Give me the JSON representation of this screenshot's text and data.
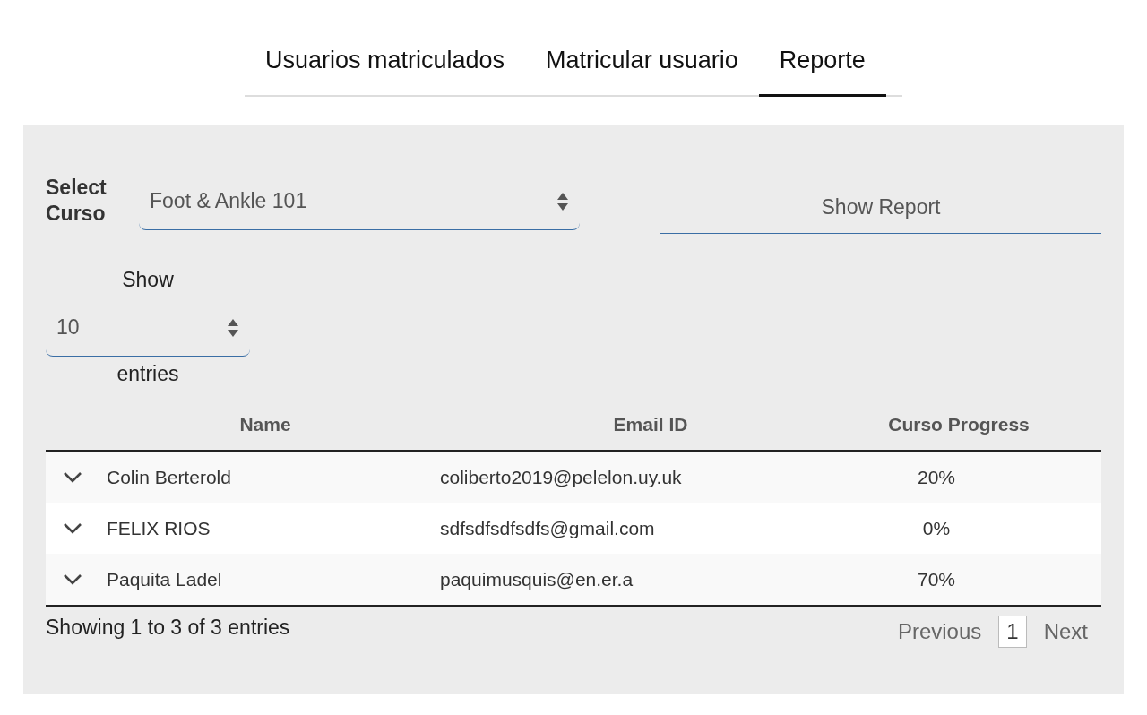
{
  "tabs": [
    {
      "label": "Usuarios matriculados",
      "selected": false
    },
    {
      "label": "Matricular usuario",
      "selected": false
    },
    {
      "label": "Reporte",
      "selected": true
    }
  ],
  "course_select": {
    "label": "Select Curso",
    "value": "Foot & Ankle 101"
  },
  "show_report_button": "Show Report",
  "length_control": {
    "prefix": "Show",
    "value": "10",
    "suffix": "entries"
  },
  "table": {
    "columns": [
      "Name",
      "Email ID",
      "Curso Progress"
    ],
    "rows": [
      {
        "name": "Colin Berterold",
        "email": "coliberto2019@pelelon.uy.uk",
        "progress": "20%"
      },
      {
        "name": "FELIX RIOS",
        "email": "sdfsdfsdfsdfs@gmail.com",
        "progress": "0%"
      },
      {
        "name": "Paquita Ladel",
        "email": "paquimusquis@en.er.a",
        "progress": "70%"
      }
    ]
  },
  "info": "Showing 1 to 3 of 3 entries",
  "pagination": [
    {
      "label": "Previous",
      "kind": "link",
      "selected": false
    },
    {
      "label": "1",
      "kind": "page",
      "selected": true
    },
    {
      "label": "Next",
      "kind": "link",
      "selected": false
    }
  ]
}
